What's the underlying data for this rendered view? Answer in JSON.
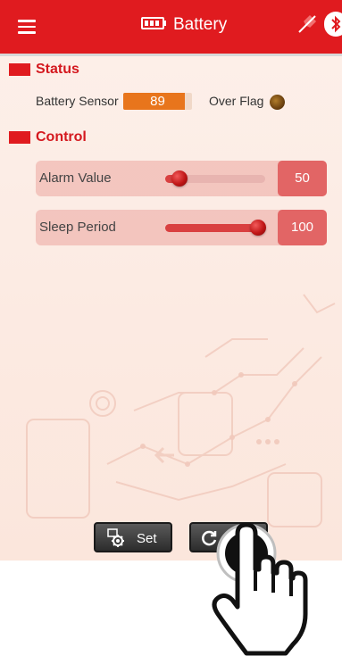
{
  "app": {
    "title": "Battery"
  },
  "icons": {
    "menu": "menu-icon",
    "battery": "battery-icon",
    "pin": "pin-disconnected-icon",
    "bluetooth": "bluetooth-icon",
    "gear": "gear-icon",
    "refresh": "refresh-icon",
    "over_flag": "led-indicator-icon",
    "hand": "pointing-hand-icon"
  },
  "status": {
    "heading": "Status",
    "battery_sensor_label": "Battery Sensor",
    "battery_sensor_value": "89",
    "battery_sensor_level": 0.89,
    "over_flag_label": "Over Flag"
  },
  "control": {
    "heading": "Control",
    "items": [
      {
        "label": "Alarm Value",
        "value": "50",
        "level": 0.14
      },
      {
        "label": "Sleep Period",
        "value": "100",
        "level": 0.93
      }
    ]
  },
  "buttons": {
    "set_label": "Set",
    "refresh_label": ""
  },
  "colors": {
    "accent": "#e01b1f",
    "sensor_fill": "#e8751c",
    "value_box": "#e26565",
    "flag_led": "#6d4210"
  }
}
